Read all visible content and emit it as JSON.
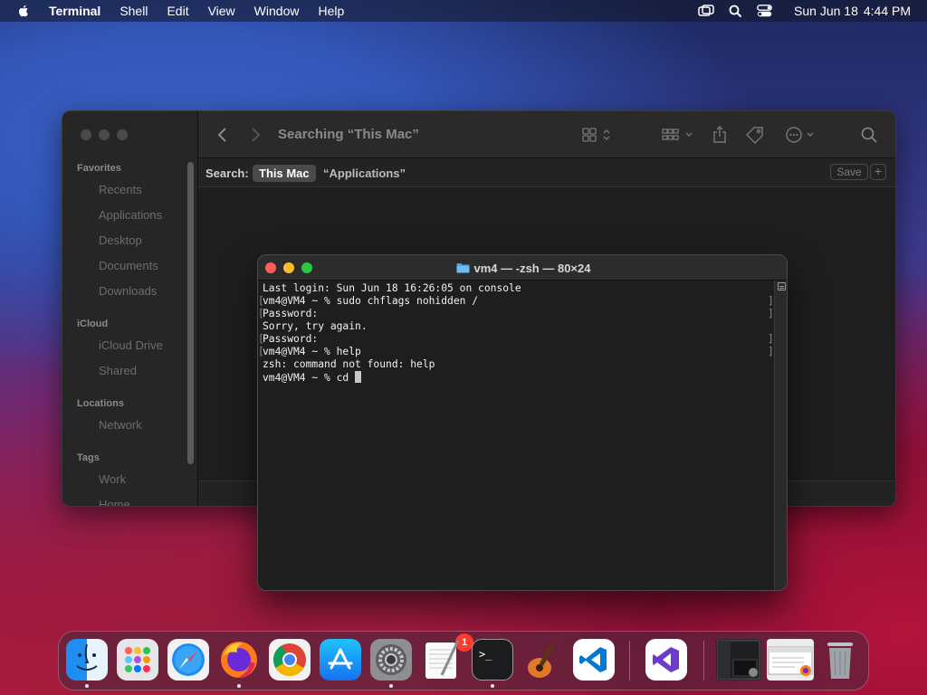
{
  "menubar": {
    "app_name": "Terminal",
    "items": [
      "Shell",
      "Edit",
      "View",
      "Window",
      "Help"
    ],
    "clock_date": "Sun Jun 18",
    "clock_time": "4:44 PM"
  },
  "finder": {
    "title": "Searching “This Mac”",
    "search_label": "Search:",
    "scope_active": "This Mac",
    "scope_other": "“Applications”",
    "save_label": "Save",
    "add_label": "+",
    "sidebar": {
      "favorites_title": "Favorites",
      "favorites": [
        "Recents",
        "Applications",
        "Desktop",
        "Documents",
        "Downloads"
      ],
      "icloud_title": "iCloud",
      "icloud": [
        "iCloud Drive",
        "Shared"
      ],
      "locations_title": "Locations",
      "locations": [
        "Network"
      ],
      "tags_title": "Tags",
      "tags": [
        "Work",
        "Home"
      ]
    }
  },
  "terminal": {
    "title": "vm4 — -zsh — 80×24",
    "lines": [
      "Last login: Sun Jun 18 16:26:05 on console",
      "vm4@VM4 ~ % sudo chflags nohidden /",
      "Password:",
      "Sorry, try again.",
      "Password:",
      "vm4@VM4 ~ % help",
      "zsh: command not found: help",
      "vm4@VM4 ~ % cd "
    ]
  },
  "dock": {
    "settings_badge": "1",
    "apps": [
      "finder-icon",
      "launchpad-icon",
      "safari-icon",
      "firefox-icon",
      "chrome-icon",
      "app-store-icon",
      "system-settings-icon",
      "textedit-icon",
      "terminal-icon",
      "garageband-icon",
      "vscode-icon",
      "visual-studio-icon",
      "finder-window-thumbnail",
      "firefox-window-thumbnail",
      "trash-icon"
    ]
  },
  "colors": {
    "close": "#fe5f57",
    "minimize": "#febc2e",
    "maximize": "#28c840",
    "badge": "#ff3b30"
  }
}
